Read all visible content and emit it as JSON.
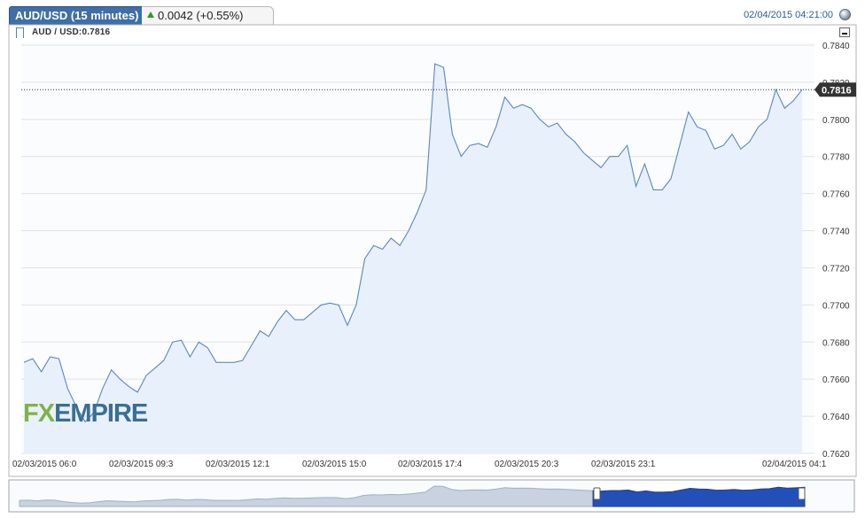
{
  "header": {
    "instrument_tab": "AUD/USD (15 minutes)",
    "change_text": "0.0042 (+0.55%)",
    "change_direction": "up",
    "datetime": "02/04/2015 04:21:00",
    "datetime_icon": "globe-icon"
  },
  "legend": {
    "label": "AUD / USD:0.7816",
    "icon": "series-marker-icon"
  },
  "minimize_icon": "minimize-icon",
  "logo": {
    "part1": "FX",
    "part2": "EMPIRE"
  },
  "colors": {
    "accent": "#3f6ea8",
    "line": "#5a86c5",
    "area": "#e8f0fb",
    "up": "#2e9b2e",
    "navigator_fill": "#2350b8",
    "last_price_bg": "#333333"
  },
  "chart_data": {
    "type": "area",
    "ylim": [
      0.762,
      0.784
    ],
    "yticks": [
      "0.7620",
      "0.7640",
      "0.7660",
      "0.7680",
      "0.7700",
      "0.7720",
      "0.7740",
      "0.7760",
      "0.7780",
      "0.7800",
      "0.7820",
      "0.7840"
    ],
    "xticks": [
      "02/03/2015 06:0",
      "02/03/2015 09:3",
      "02/03/2015 12:1",
      "02/03/2015 15:0",
      "02/03/2015 17:4",
      "02/03/2015 20:3",
      "02/03/2015 23:1",
      "02/04/2015 04:1"
    ],
    "last_value_label": "0.7816",
    "last_value": 0.7816,
    "grid": true,
    "series": [
      {
        "values": [
          0.7669,
          0.7671,
          0.7664,
          0.7672,
          0.7671,
          0.7655,
          0.7645,
          0.7637,
          0.7642,
          0.7655,
          0.7665,
          0.766,
          0.7656,
          0.7653,
          0.7662,
          0.7666,
          0.767,
          0.768,
          0.7681,
          0.7672,
          0.768,
          0.7677,
          0.7669,
          0.7669,
          0.7669,
          0.767,
          0.7678,
          0.7686,
          0.7683,
          0.7691,
          0.7697,
          0.7692,
          0.7692,
          0.7696,
          0.77,
          0.7701,
          0.77,
          0.7689,
          0.77,
          0.7725,
          0.7732,
          0.773,
          0.7736,
          0.7732,
          0.774,
          0.775,
          0.7762,
          0.783,
          0.7828,
          0.7792,
          0.778,
          0.7786,
          0.7787,
          0.7785,
          0.7796,
          0.7812,
          0.7806,
          0.7808,
          0.7806,
          0.78,
          0.7796,
          0.7798,
          0.7792,
          0.7788,
          0.7782,
          0.7778,
          0.7774,
          0.778,
          0.778,
          0.7786,
          0.7764,
          0.7776,
          0.7762,
          0.7762,
          0.7768,
          0.7786,
          0.7804,
          0.7796,
          0.7794,
          0.7784,
          0.7786,
          0.7792,
          0.7784,
          0.7788,
          0.7796,
          0.78,
          0.7816,
          0.7806,
          0.781,
          0.7816
        ]
      }
    ]
  }
}
